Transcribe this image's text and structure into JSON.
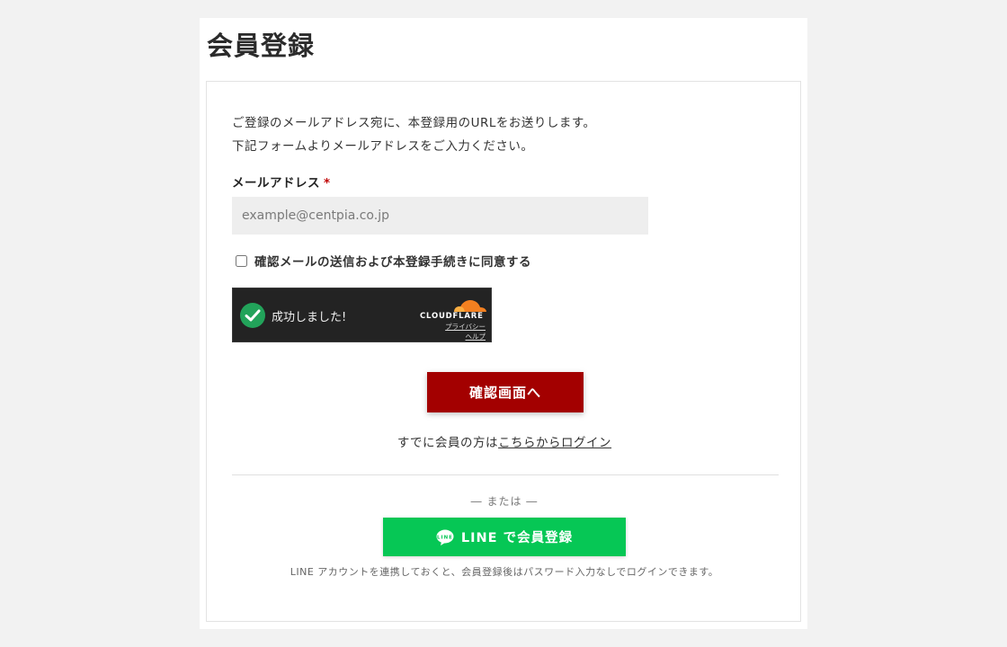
{
  "page": {
    "title": "会員登録"
  },
  "intro": {
    "line1": "ご登録のメールアドレス宛に、本登録用のURLをお送りします。",
    "line2": "下記フォームよりメールアドレスをご入力ください。"
  },
  "form": {
    "email_label": "メールアドレス",
    "required_mark": "*",
    "email_value": "",
    "email_placeholder": "example@centpia.co.jp",
    "agree_label": "確認メールの送信および本登録手続きに同意する",
    "agree_checked": false
  },
  "captcha": {
    "status": "成功しました!",
    "brand": "CLOUDFLARE",
    "privacy_link": "プライバシー",
    "help_link": "ヘルプ",
    "colors": {
      "success": "#22a35a",
      "brand_orange": "#f38020",
      "bg": "#232323"
    }
  },
  "actions": {
    "confirm_label": "確認画面へ",
    "login_prefix": "すでに会員の方は",
    "login_link": "こちらからログイン",
    "or_text": "― または ―",
    "line_register_label": "LINE で会員登録",
    "line_note": "LINE アカウントを連携しておくと、会員登録後はパスワード入力なしでログインできます。"
  },
  "colors": {
    "confirm_button": "#a30000",
    "line_button": "#06c755",
    "required": "#c00000"
  },
  "icons": {
    "captcha_check": "check-circle-icon",
    "cloudflare": "cloudflare-cloud-icon",
    "line": "line-speech-bubble-icon"
  }
}
